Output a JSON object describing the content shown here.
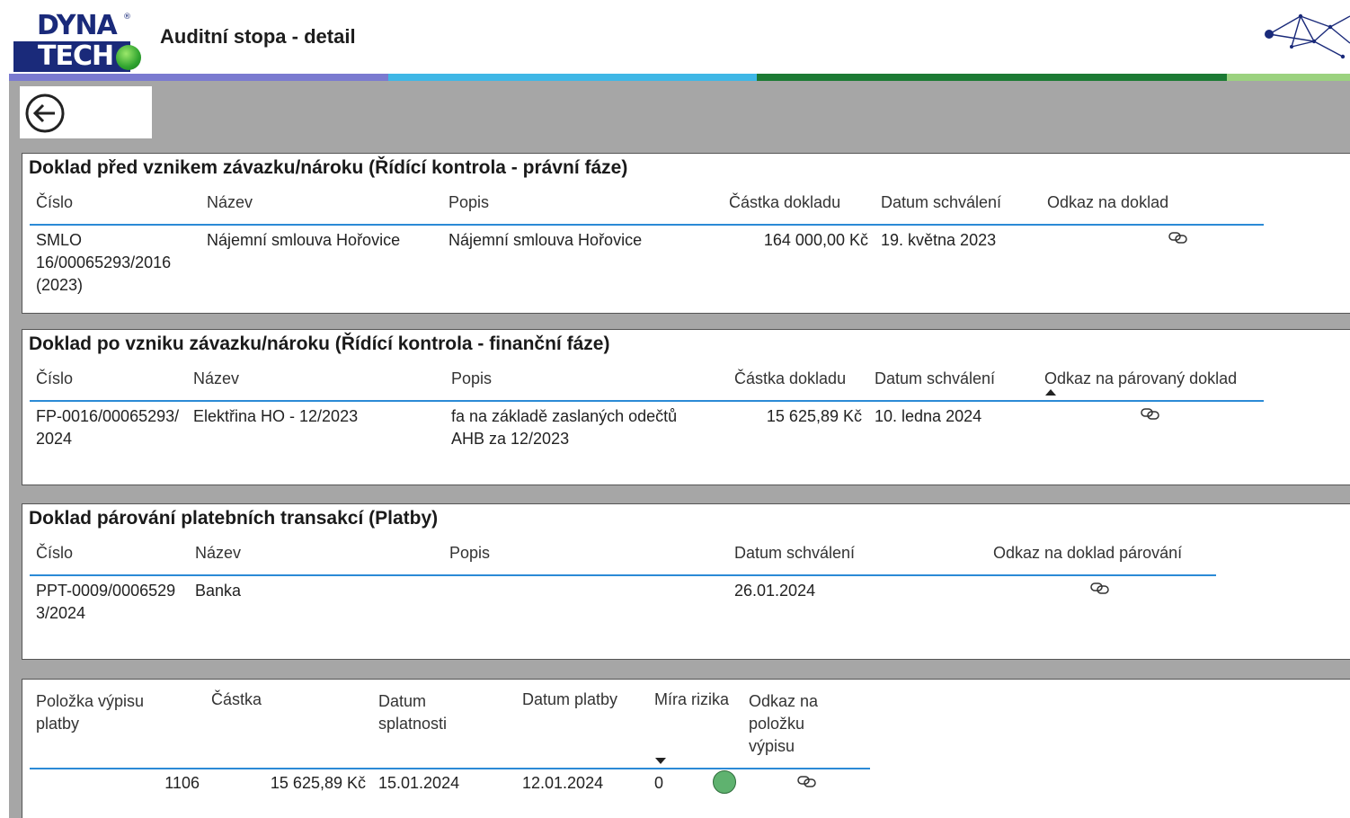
{
  "header": {
    "logo_top": "DYNA",
    "logo_bottom": "TECH",
    "logo_reg": "®",
    "title": "Auditní stopa - detail",
    "stripe_colors": [
      "#7a7ad0",
      "#3fb7e6",
      "#1c7a34",
      "#9bd27f"
    ]
  },
  "back_button": {
    "icon": "arrow-left-circle-icon"
  },
  "section1": {
    "title": "Doklad před vznikem závazku/nároku (Řídící kontrola - právní fáze)",
    "columns": [
      "Číslo",
      "Název",
      "Popis",
      "Částka dokladu",
      "Datum schválení",
      "Odkaz na doklad"
    ],
    "row": {
      "cislo": "SMLO 16/00065293/2016 (2023)",
      "nazev": "Nájemní smlouva Hořovice",
      "popis": "Nájemní smlouva Hořovice",
      "castka": "164 000,00 Kč",
      "datum": "19. května 2023",
      "odkaz_icon": "link-icon"
    }
  },
  "section2": {
    "title": "Doklad po vzniku závazku/nároku (Řídící kontrola - finanční fáze)",
    "columns": [
      "Číslo",
      "Název",
      "Popis",
      "Částka dokladu",
      "Datum schválení",
      "Odkaz na párovaný doklad"
    ],
    "sorted_column": "Odkaz na párovaný doklad",
    "sort_direction": "ascending",
    "row": {
      "cislo": "FP-0016/00065293/2024",
      "nazev": "Elektřina HO - 12/2023",
      "popis": "fa na základě zaslaných odečtů AHB za 12/2023",
      "castka": "15 625,89 Kč",
      "datum": "10. ledna 2024",
      "odkaz_icon": "link-icon"
    }
  },
  "section3": {
    "title": "Doklad párování platebních transakcí (Platby)",
    "columns": [
      "Číslo",
      "Název",
      "Popis",
      "Datum schválení",
      "Odkaz na doklad párování"
    ],
    "row": {
      "cislo": "PPT-0009/00065293/2024",
      "nazev": "Banka",
      "popis": "",
      "datum": "26.01.2024",
      "odkaz_icon": "link-icon"
    }
  },
  "section4": {
    "columns": [
      "Položka výpisu platby",
      "Částka",
      "Datum splatnosti",
      "Datum platby",
      "Míra rizika",
      "Odkaz na položku výpisu"
    ],
    "sorted_column": "Míra rizika",
    "sort_direction": "descending",
    "row": {
      "polozka": "1106",
      "castka": "15 625,89 Kč",
      "splatnost": "15.01.2024",
      "platba": "12.01.2024",
      "riziko": "0",
      "riziko_color": "#5fb26f",
      "odkaz_icon": "link-icon"
    }
  }
}
